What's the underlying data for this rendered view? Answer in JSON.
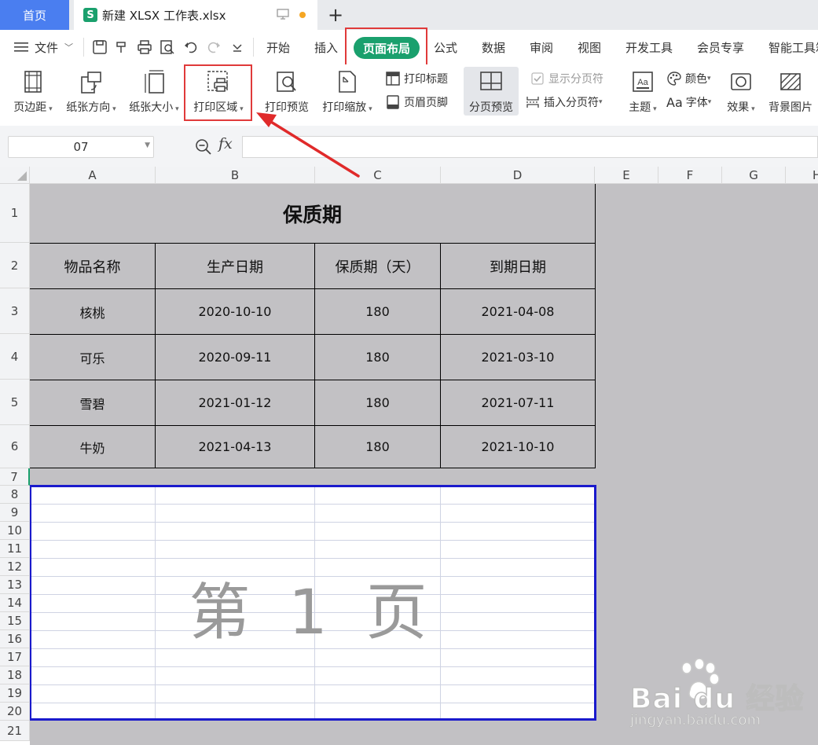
{
  "tabs": {
    "home": "首页",
    "doc_icon": "S",
    "doc_title": "新建 XLSX 工作表.xlsx",
    "new_tab": "+"
  },
  "menu": {
    "file": "文件",
    "items": [
      "开始",
      "插入",
      "页面布局",
      "公式",
      "数据",
      "审阅",
      "视图",
      "开发工具",
      "会员专享",
      "智能工具箱"
    ],
    "active": "页面布局"
  },
  "ribbon": {
    "margins": "页边距",
    "orientation": "纸张方向",
    "size": "纸张大小",
    "print_area": "打印区域",
    "print_preview": "打印预览",
    "print_scale": "打印缩放",
    "print_titles": "打印标题",
    "header_footer": "页眉页脚",
    "page_break_preview": "分页预览",
    "show_page_breaks": "显示分页符",
    "insert_page_break": "插入分页符",
    "theme": "主题",
    "colors": "颜色",
    "fonts": "字体",
    "fonts_prefix": "Aa",
    "effects": "效果",
    "background": "背景图片"
  },
  "formula_bar": {
    "cell_ref": "07",
    "fx_label": "fx",
    "value": ""
  },
  "columns": [
    "A",
    "B",
    "C",
    "D",
    "E",
    "F",
    "G",
    "H"
  ],
  "rows": [
    "1",
    "2",
    "3",
    "4",
    "5",
    "6",
    "7",
    "8",
    "9",
    "10",
    "11",
    "12",
    "13",
    "14",
    "15",
    "16",
    "17",
    "18",
    "19",
    "20",
    "21"
  ],
  "sheet": {
    "title": "保质期",
    "headers": [
      "物品名称",
      "生产日期",
      "保质期（天）",
      "到期日期"
    ],
    "data": [
      [
        "核桃",
        "2020-10-10",
        "180",
        "2021-04-08"
      ],
      [
        "可乐",
        "2020-09-11",
        "180",
        "2021-03-10"
      ],
      [
        "雪碧",
        "2021-01-12",
        "180",
        "2021-07-11"
      ],
      [
        "牛奶",
        "2021-04-13",
        "180",
        "2021-10-10"
      ]
    ],
    "page_watermark": "第 1 页"
  },
  "baidu": {
    "logo": "Bai du 经验",
    "url": "jingyan.baidu.com"
  },
  "colors": {
    "accent": "#1aa06d",
    "home_tab": "#4a7ef0",
    "highlight": "#e03a3a",
    "page_border": "#1a1acc"
  }
}
